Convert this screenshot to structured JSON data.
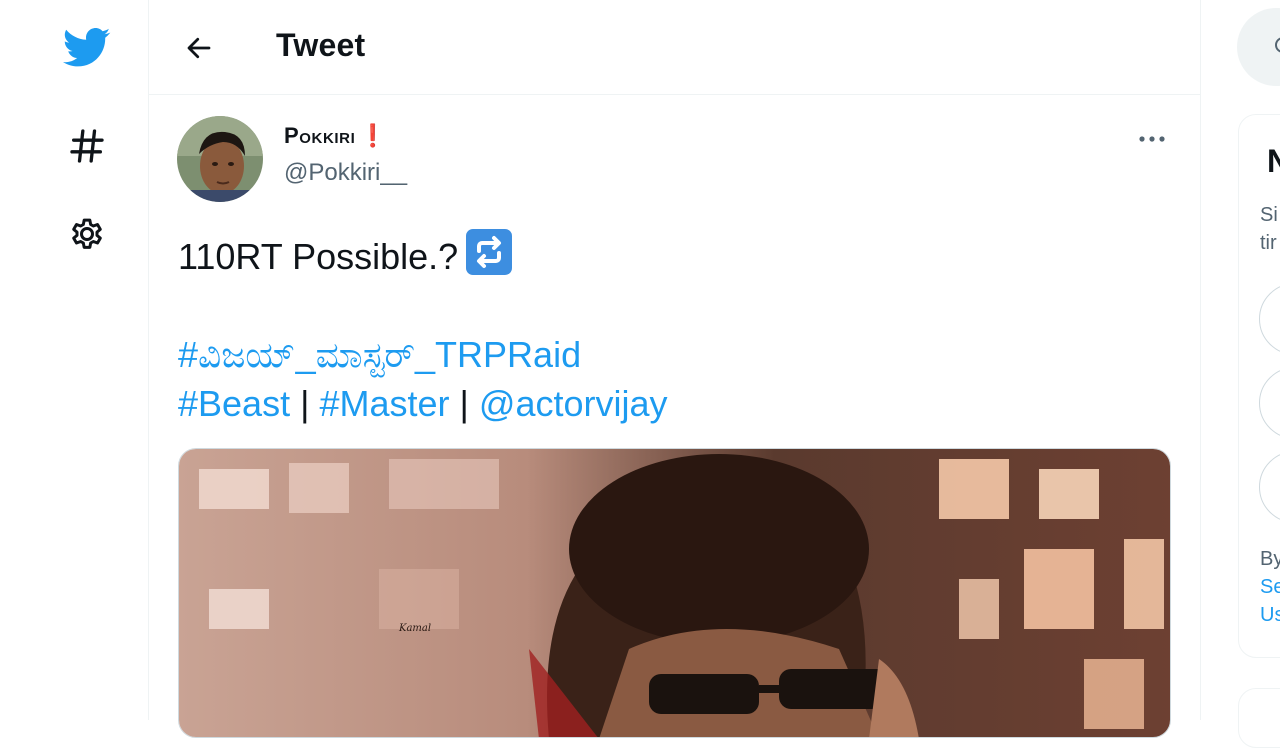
{
  "nav": {
    "logo_icon": "twitter-bird-icon",
    "items": [
      {
        "name": "explore",
        "icon": "hashtag-icon"
      },
      {
        "name": "settings",
        "icon": "gear-icon"
      }
    ],
    "brand_color": "#1d9bf0"
  },
  "header": {
    "back_icon": "arrow-left-icon",
    "title": "Tweet"
  },
  "tweet": {
    "author": {
      "name": "Pokkiri",
      "name_emoji": "❗",
      "handle": "@Pokkiri__"
    },
    "text_line1": "110RT Possible.?",
    "text_line1_emoji": "repeat-button-emoji",
    "hashtag_line1": "#ವಿಜಯ್_ಮಾಸ್ಟರ್_TRPRaid",
    "hashtag_beast": "#Beast",
    "hashtag_master": "#Master",
    "mention": "@actorvijay",
    "separator": "|",
    "media_watermark": "Kamal",
    "more_icon": "more-horizontal-icon"
  },
  "right": {
    "search_icon": "search-icon",
    "card_title": "N",
    "card_sub_line1": "Si",
    "card_sub_line2": "tir",
    "legal_prefix": "By",
    "legal_link1": "Se",
    "legal_link2": "Us"
  }
}
